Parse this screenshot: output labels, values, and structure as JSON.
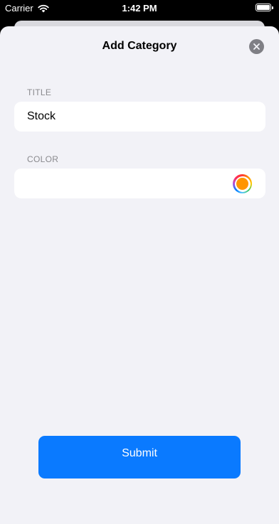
{
  "status_bar": {
    "carrier": "Carrier",
    "time": "1:42 PM",
    "battery_level": 1.0
  },
  "sheet": {
    "title": "Add Category",
    "close_icon": "xmark-icon"
  },
  "form": {
    "title_label": "TITLE",
    "title_value": "Stock",
    "color_label": "COLOR",
    "selected_color": "#ff9500"
  },
  "actions": {
    "submit_label": "Submit"
  },
  "colors": {
    "accent": "#0a7aff",
    "sheet_background": "#f2f2f7",
    "field_background": "#ffffff",
    "label_gray": "#8a8a8e"
  }
}
